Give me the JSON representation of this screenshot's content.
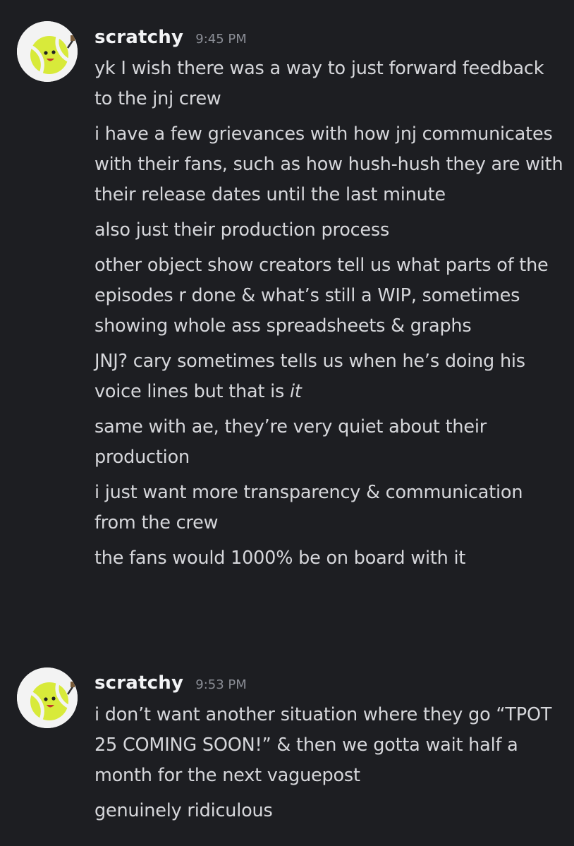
{
  "groups": [
    {
      "username": "scratchy",
      "timestamp": "9:45 PM",
      "messages": [
        "yk I wish there was a way to just forward feedback to the jnj crew",
        "i have a few grievances with how jnj communicates with their fans, such as how hush-hush they are with their release dates until the last minute",
        "also just their production process",
        "other object show creators tell us what parts of the episodes r done & what’s still a WIP, sometimes showing whole ass spreadsheets & graphs",
        {
          "prefix": "JNJ? cary sometimes tells us when he’s doing his voice lines but that is ",
          "emphasis": "it"
        },
        "same with ae, they’re very quiet about their production",
        "i just want more transparency & communication from the crew",
        "the fans would 1000% be on board with it"
      ]
    },
    {
      "username": "scratchy",
      "timestamp": "9:53 PM",
      "messages": [
        "i don’t want another situation where they go “TPOT 25 COMING SOON!” & then we gotta wait half a month for the next vaguepost",
        "genuinely ridiculous"
      ]
    }
  ]
}
